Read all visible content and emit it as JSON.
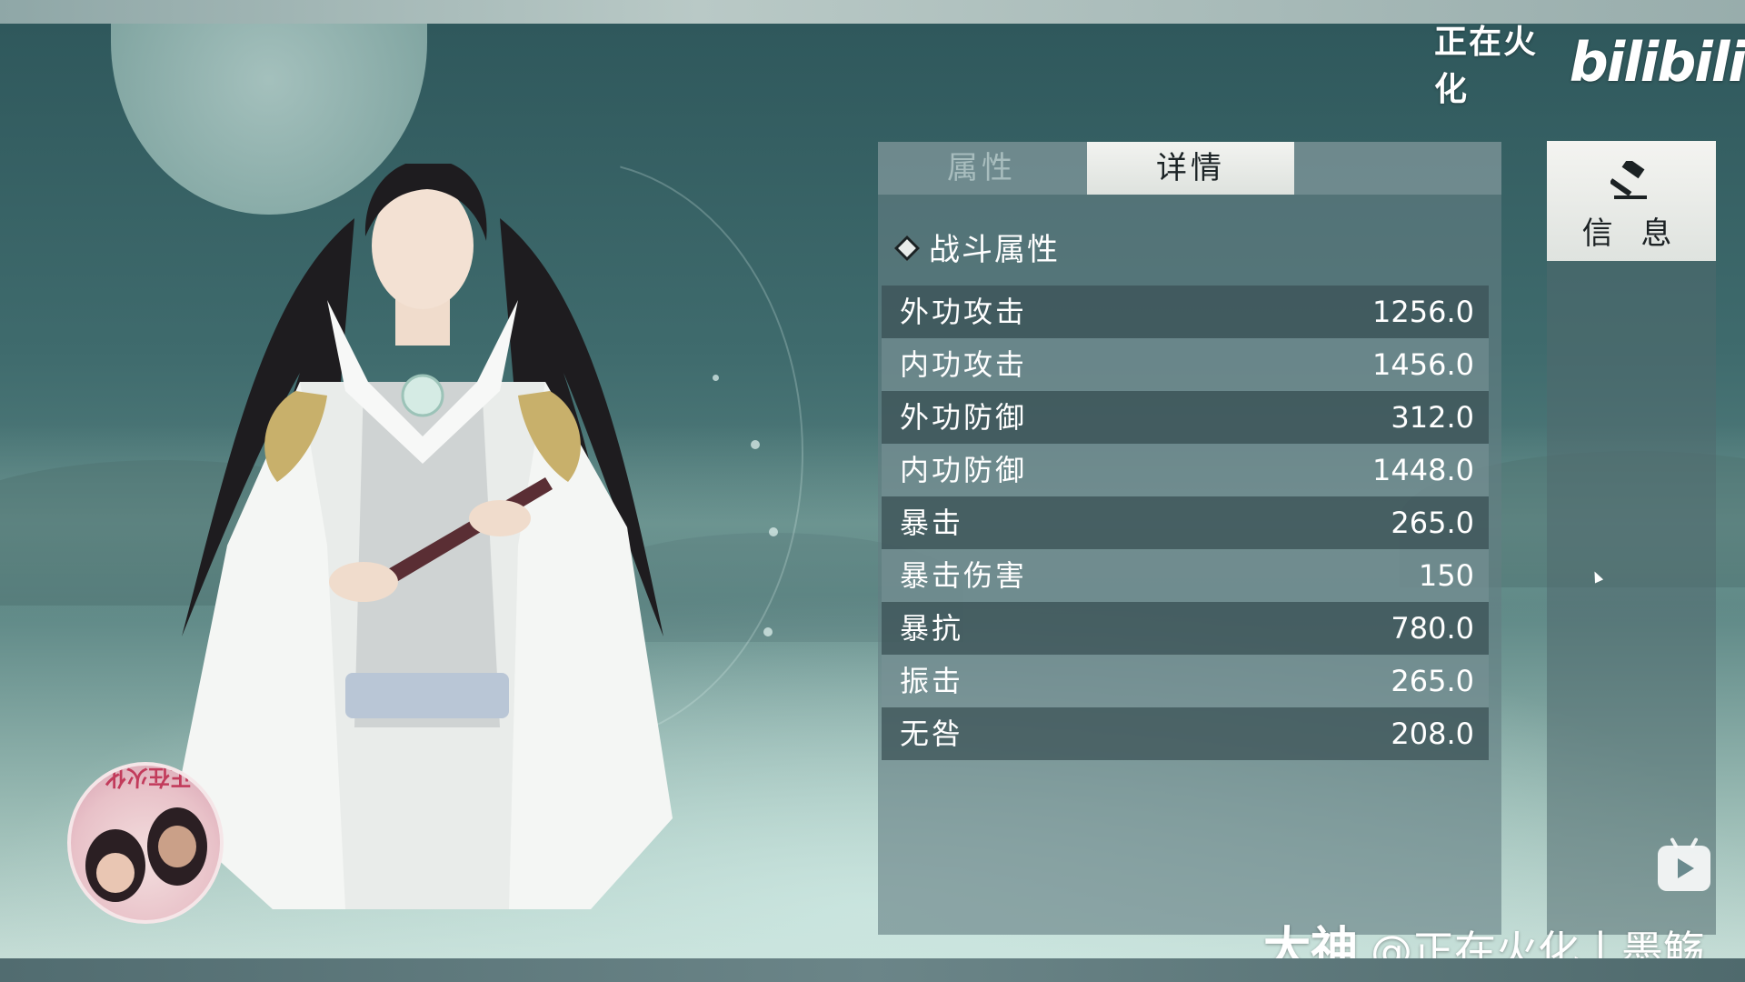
{
  "logo": {
    "channel": "正在火化",
    "brand": "bilibili"
  },
  "tabs": [
    {
      "label": "属性",
      "active": false
    },
    {
      "label": "详情",
      "active": true
    }
  ],
  "section": {
    "title": "战斗属性"
  },
  "stats": [
    {
      "name": "外功攻击",
      "value": "1256.0"
    },
    {
      "name": "内功攻击",
      "value": "1456.0"
    },
    {
      "name": "外功防御",
      "value": "312.0"
    },
    {
      "name": "内功防御",
      "value": "1448.0"
    },
    {
      "name": "暴击",
      "value": "265.0"
    },
    {
      "name": "暴击伤害",
      "value": "150"
    },
    {
      "name": "暴抗",
      "value": "780.0"
    },
    {
      "name": "振击",
      "value": "265.0"
    },
    {
      "name": "无咎",
      "value": "208.0"
    }
  ],
  "side": {
    "info_label": "信 息",
    "info_icon": "hammer-icon"
  },
  "avatar": {
    "tag": "正在火化"
  },
  "watermark": {
    "brand": "大神",
    "handle": "@正在火化丨墨觞"
  },
  "colors": {
    "panel": "#647e82",
    "active_tab": "#eceeeb",
    "text": "#ffffff"
  }
}
